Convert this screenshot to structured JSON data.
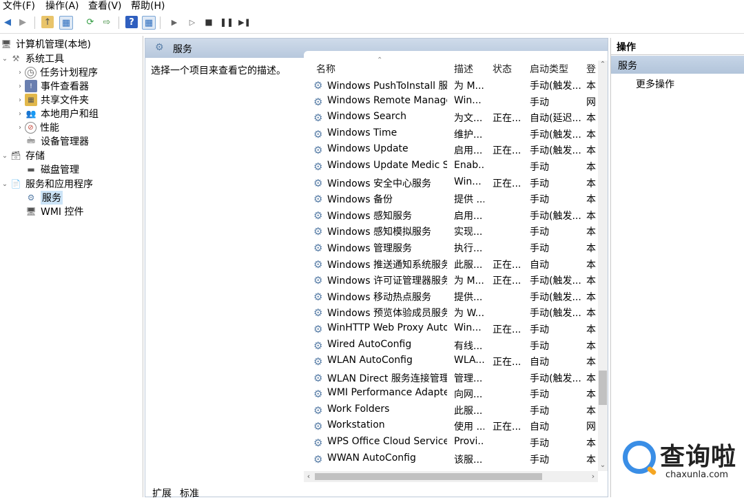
{
  "menubar": {
    "file": "文件(F)",
    "action": "操作(A)",
    "view": "查看(V)",
    "help": "帮助(H)"
  },
  "tree": {
    "root": "计算机管理(本地)",
    "system_tools": "系统工具",
    "task_scheduler": "任务计划程序",
    "event_viewer": "事件查看器",
    "shared_folders": "共享文件夹",
    "local_users": "本地用户和组",
    "performance": "性能",
    "device_manager": "设备管理器",
    "storage": "存储",
    "disk_management": "磁盘管理",
    "services_apps": "服务和应用程序",
    "services": "服务",
    "wmi": "WMI 控件"
  },
  "center": {
    "title": "服务",
    "description": "选择一个项目来查看它的描述。",
    "columns": {
      "name": "名称",
      "desc": "描述",
      "status": "状态",
      "startup": "启动类型",
      "logon": "登"
    },
    "rows": [
      {
        "name": "Windows PushToInstall 服务",
        "desc": "为 M...",
        "status": "",
        "startup": "手动(触发...",
        "logon": "本"
      },
      {
        "name": "Windows Remote Manage...",
        "desc": "Win...",
        "status": "",
        "startup": "手动",
        "logon": "网"
      },
      {
        "name": "Windows Search",
        "desc": "为文...",
        "status": "正在...",
        "startup": "自动(延迟...",
        "logon": "本"
      },
      {
        "name": "Windows Time",
        "desc": "维护...",
        "status": "",
        "startup": "手动(触发...",
        "logon": "本"
      },
      {
        "name": "Windows Update",
        "desc": "启用...",
        "status": "正在...",
        "startup": "手动(触发...",
        "logon": "本"
      },
      {
        "name": "Windows Update Medic Se...",
        "desc": "Enab...",
        "status": "",
        "startup": "手动",
        "logon": "本"
      },
      {
        "name": "Windows 安全中心服务",
        "desc": "Win...",
        "status": "正在...",
        "startup": "手动",
        "logon": "本"
      },
      {
        "name": "Windows 备份",
        "desc": "提供 ...",
        "status": "",
        "startup": "手动",
        "logon": "本"
      },
      {
        "name": "Windows 感知服务",
        "desc": "启用...",
        "status": "",
        "startup": "手动(触发...",
        "logon": "本"
      },
      {
        "name": "Windows 感知模拟服务",
        "desc": "实现...",
        "status": "",
        "startup": "手动",
        "logon": "本"
      },
      {
        "name": "Windows 管理服务",
        "desc": "执行...",
        "status": "",
        "startup": "手动",
        "logon": "本"
      },
      {
        "name": "Windows 推送通知系统服务",
        "desc": "此服...",
        "status": "正在...",
        "startup": "自动",
        "logon": "本"
      },
      {
        "name": "Windows 许可证管理器服务",
        "desc": "为 M...",
        "status": "正在...",
        "startup": "手动(触发...",
        "logon": "本"
      },
      {
        "name": "Windows 移动热点服务",
        "desc": "提供...",
        "status": "",
        "startup": "手动(触发...",
        "logon": "本"
      },
      {
        "name": "Windows 预览体验成员服务",
        "desc": "为 W...",
        "status": "",
        "startup": "手动(触发...",
        "logon": "本"
      },
      {
        "name": "WinHTTP Web Proxy Auto...",
        "desc": "Win...",
        "status": "正在...",
        "startup": "手动",
        "logon": "本"
      },
      {
        "name": "Wired AutoConfig",
        "desc": "有线...",
        "status": "",
        "startup": "手动",
        "logon": "本"
      },
      {
        "name": "WLAN AutoConfig",
        "desc": "WLA...",
        "status": "正在...",
        "startup": "自动",
        "logon": "本"
      },
      {
        "name": "WLAN Direct 服务连接管理...",
        "desc": "管理...",
        "status": "",
        "startup": "手动(触发...",
        "logon": "本"
      },
      {
        "name": "WMI Performance Adapter",
        "desc": "向网...",
        "status": "",
        "startup": "手动",
        "logon": "本"
      },
      {
        "name": "Work Folders",
        "desc": "此服...",
        "status": "",
        "startup": "手动",
        "logon": "本"
      },
      {
        "name": "Workstation",
        "desc": "使用 ...",
        "status": "正在...",
        "startup": "自动",
        "logon": "网"
      },
      {
        "name": "WPS Office Cloud Service",
        "desc": "Provi...",
        "status": "",
        "startup": "手动",
        "logon": "本"
      },
      {
        "name": "WWAN AutoConfig",
        "desc": "该服...",
        "status": "",
        "startup": "手动",
        "logon": "本"
      }
    ],
    "tabs": {
      "extended": "扩展",
      "standard": "标准"
    }
  },
  "actions": {
    "header": "操作",
    "group": "服务",
    "more": "更多操作"
  },
  "watermark": {
    "brand": "查询啦",
    "url": "chaxunla.com"
  },
  "colors": {
    "header_blue": "#b7c8dd",
    "selection": "#cce4f7",
    "logo_blue": "#3a8ee6",
    "logo_orange": "#f5a623"
  }
}
